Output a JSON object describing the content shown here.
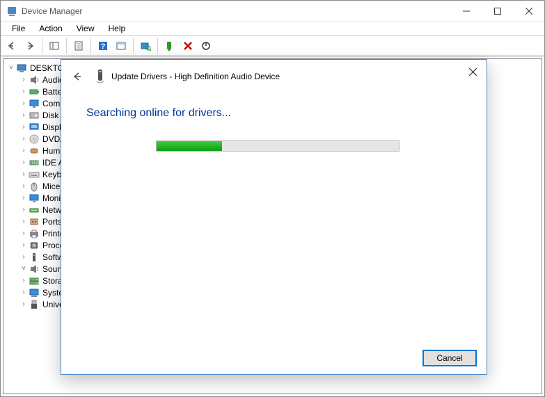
{
  "window": {
    "title": "Device Manager",
    "controls": {
      "minimize": "Minimize",
      "maximize": "Maximize",
      "close": "Close"
    }
  },
  "menu": {
    "file": "File",
    "action": "Action",
    "view": "View",
    "help": "Help"
  },
  "tree": {
    "root": "DESKTOP",
    "items": [
      {
        "label": "Audio",
        "icon": "speaker"
      },
      {
        "label": "Batteries",
        "icon": "battery"
      },
      {
        "label": "Computer",
        "icon": "monitor"
      },
      {
        "label": "Disk drives",
        "icon": "disk"
      },
      {
        "label": "Display adapters",
        "icon": "display"
      },
      {
        "label": "DVD/CD-ROM drives",
        "icon": "disc"
      },
      {
        "label": "Human Interface Devices",
        "icon": "hid"
      },
      {
        "label": "IDE ATA/ATAPI controllers",
        "icon": "ide"
      },
      {
        "label": "Keyboards",
        "icon": "keyboard"
      },
      {
        "label": "Mice and other pointing devices",
        "icon": "mouse"
      },
      {
        "label": "Monitors",
        "icon": "monitor"
      },
      {
        "label": "Network adapters",
        "icon": "network"
      },
      {
        "label": "Ports (COM & LPT)",
        "icon": "port"
      },
      {
        "label": "Printers",
        "icon": "printer"
      },
      {
        "label": "Processors",
        "icon": "cpu"
      },
      {
        "label": "Software devices",
        "icon": "software"
      },
      {
        "label": "Sound, video and game controllers",
        "icon": "speaker",
        "expanded": true
      },
      {
        "label": "Storage controllers",
        "icon": "storage"
      },
      {
        "label": "System devices",
        "icon": "system"
      },
      {
        "label": "Universal Serial Bus controllers",
        "icon": "usb"
      }
    ]
  },
  "dialog": {
    "title": "Update Drivers - High Definition Audio Device",
    "heading": "Searching online for drivers...",
    "progress_percent": 27,
    "cancel": "Cancel"
  }
}
